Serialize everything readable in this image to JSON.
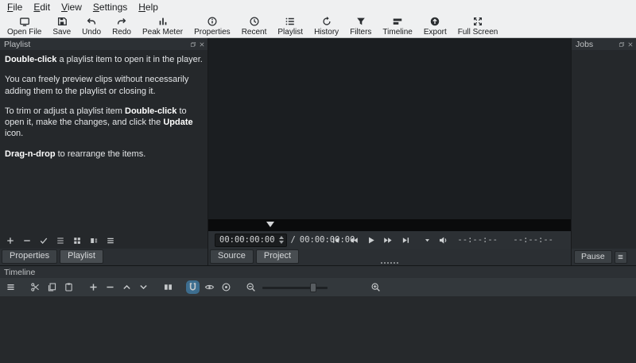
{
  "menu": {
    "items": [
      "File",
      "Edit",
      "View",
      "Settings",
      "Help"
    ]
  },
  "toolbar": {
    "buttons": [
      {
        "icon": "open-file-icon",
        "label": "Open File"
      },
      {
        "icon": "save-icon",
        "label": "Save"
      },
      {
        "icon": "undo-icon",
        "label": "Undo"
      },
      {
        "icon": "redo-icon",
        "label": "Redo"
      },
      {
        "icon": "peak-meter-icon",
        "label": "Peak Meter"
      },
      {
        "icon": "properties-icon",
        "label": "Properties"
      },
      {
        "icon": "recent-icon",
        "label": "Recent"
      },
      {
        "icon": "playlist-icon",
        "label": "Playlist"
      },
      {
        "icon": "history-icon",
        "label": "History"
      },
      {
        "icon": "filters-icon",
        "label": "Filters"
      },
      {
        "icon": "timeline-icon",
        "label": "Timeline"
      },
      {
        "icon": "export-icon",
        "label": "Export"
      },
      {
        "icon": "full-screen-icon",
        "label": "Full Screen"
      }
    ]
  },
  "playlist_panel": {
    "title": "Playlist",
    "help": {
      "p1a": "Double-click",
      "p1b": " a playlist item to open it in the player.",
      "p2": "You can freely preview clips without necessarily adding them to the playlist or closing it.",
      "p3a": "To trim or adjust a playlist item ",
      "p3b": "Double-click",
      "p3c": " to open it, make the changes, and click the ",
      "p3d": "Update",
      "p3e": " icon.",
      "p4a": "Drag-n-drop",
      "p4b": " to rearrange the items."
    },
    "tool_icons": [
      "add",
      "remove",
      "update",
      "view-details",
      "view-icons",
      "view-tiles",
      "menu"
    ]
  },
  "left_tabs": [
    {
      "label": "Properties"
    },
    {
      "label": "Playlist"
    }
  ],
  "player": {
    "current_time": "00:00:00:00",
    "separator": "/",
    "total_time": "00:00:00:00",
    "in_point": "--:--:--",
    "selected_duration": "--:--:--",
    "seek_position_pct": 17,
    "transport_icons": [
      "skip-to-start",
      "rewind",
      "play",
      "fast-forward",
      "skip-to-end",
      "player-menu-caret",
      "volume"
    ],
    "tabs": [
      {
        "label": "Source"
      },
      {
        "label": "Project"
      }
    ]
  },
  "jobs_panel": {
    "title": "Jobs",
    "pause_label": "Pause",
    "tool_icons": [
      "menu"
    ]
  },
  "timeline_panel": {
    "title": "Timeline",
    "zoom_slider_pct": 78,
    "tool_icons": [
      "menu",
      "cut",
      "copy",
      "paste",
      "append",
      "ripple-delete",
      "lift",
      "overwrite",
      "split",
      "snap",
      "scrub-while-dragging",
      "ripple-all-tracks",
      "zoom-out",
      "zoom-slider",
      "zoom-in"
    ],
    "snap_enabled": true
  },
  "colors": {
    "toolbar_bg": "#eff0f1",
    "dock_bg": "#25282b",
    "header_bg": "#2c3034",
    "accent_active": "#3d6e90"
  }
}
